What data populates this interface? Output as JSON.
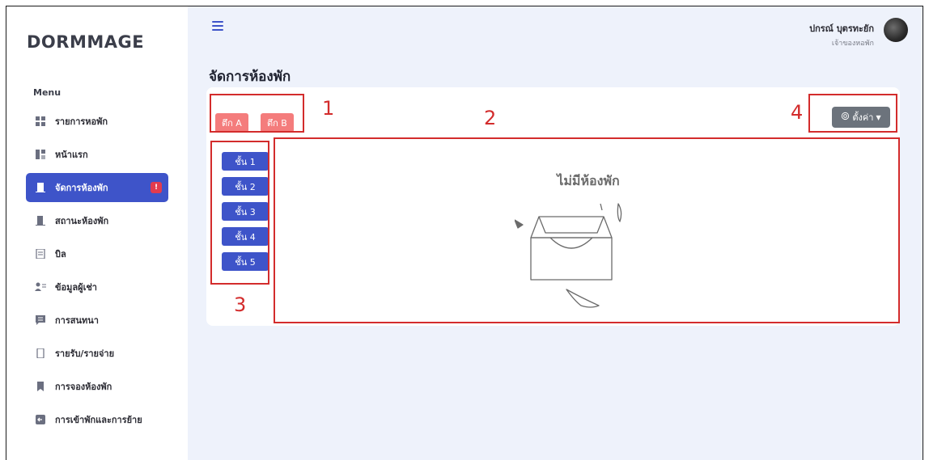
{
  "app": {
    "brand": "DORMMAGE"
  },
  "sidebar": {
    "menu_title": "Menu",
    "items": [
      {
        "label": "รายการหอพัก",
        "icon": "grid-icon",
        "active": false
      },
      {
        "label": "หน้าแรก",
        "icon": "dashboard-icon",
        "active": false
      },
      {
        "label": "จัดการห้องพัก",
        "icon": "door-icon",
        "active": true,
        "badge": "!"
      },
      {
        "label": "สถานะห้องพัก",
        "icon": "door-status-icon",
        "active": false
      },
      {
        "label": "บิล",
        "icon": "bill-icon",
        "active": false
      },
      {
        "label": "ข้อมูลผู้เช่า",
        "icon": "tenant-icon",
        "active": false
      },
      {
        "label": "การสนทนา",
        "icon": "chat-icon",
        "active": false
      },
      {
        "label": "รายรับ/รายจ่าย",
        "icon": "wallet-icon",
        "active": false
      },
      {
        "label": "การจองห้องพัก",
        "icon": "booking-icon",
        "active": false
      },
      {
        "label": "การเข้าพักและการย้าย",
        "icon": "move-icon",
        "active": false
      }
    ]
  },
  "header": {
    "user_name": "ปกรณ์ บุตรทะยัก",
    "user_role": "เจ้าของหอพัก"
  },
  "page": {
    "title": "จัดการห้องพัก",
    "buildings": [
      "ตึก A",
      "ตึก B"
    ],
    "floors": [
      "ชั้น 1",
      "ชั้น 2",
      "ชั้น 3",
      "ชั้น 4",
      "ชั้น 5"
    ],
    "settings_label": "ตั้งค่า",
    "empty_message": "ไม่มีห้องพัก"
  },
  "annotations": [
    "1",
    "2",
    "3",
    "4"
  ],
  "colors": {
    "accent": "#3e54c9",
    "building_button": "#f47c7c",
    "settings_button": "#6c737c",
    "annotation": "#d32c2c",
    "badge": "#e23b4e",
    "background": "#eef2fb"
  }
}
